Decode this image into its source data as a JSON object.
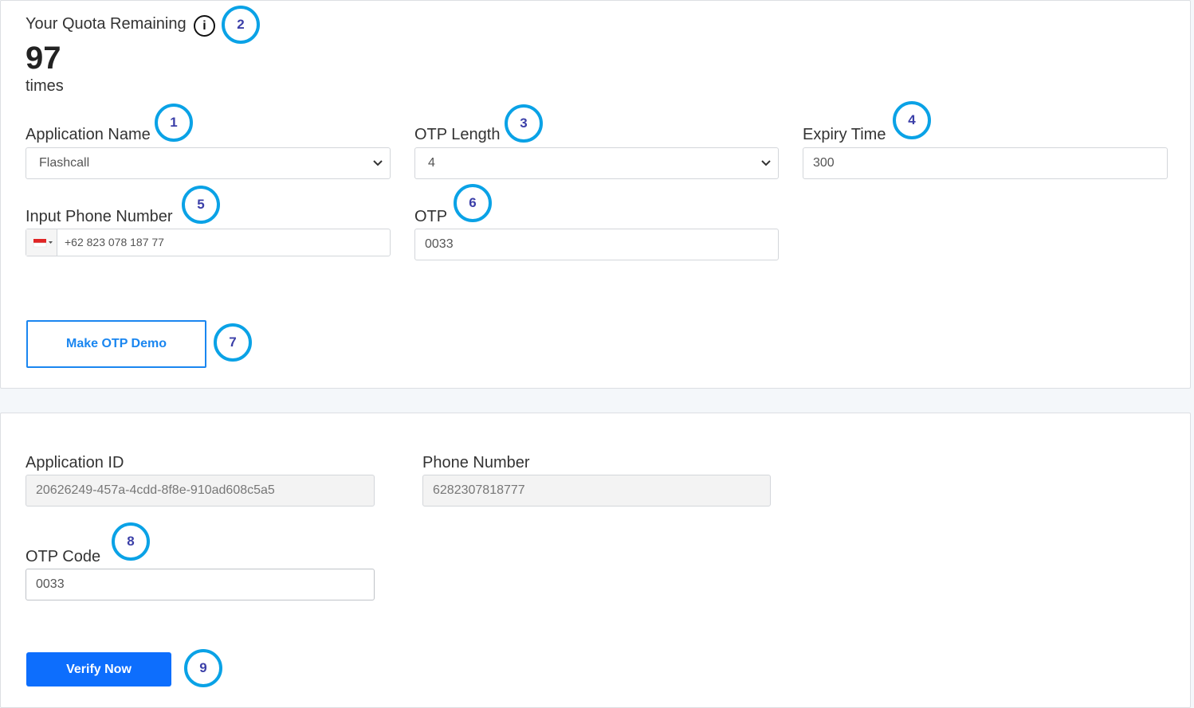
{
  "quota": {
    "title": "Your Quota Remaining",
    "info_icon": "info-icon",
    "count": "97",
    "unit": "times"
  },
  "form": {
    "app_name": {
      "label": "Application Name",
      "value": "Flashcall"
    },
    "otp_length": {
      "label": "OTP Length",
      "value": "4"
    },
    "expiry_time": {
      "label": "Expiry Time",
      "value": "300"
    },
    "phone": {
      "label": "Input Phone Number",
      "value": "+62 823 078 187 77",
      "country_icon": "indonesia-flag-icon"
    },
    "otp": {
      "label": "OTP",
      "value": "0033"
    },
    "make_button": "Make OTP Demo"
  },
  "verify": {
    "app_id": {
      "label": "Application ID",
      "value": "20626249-457a-4cdd-8f8e-910ad608c5a5"
    },
    "phone_number": {
      "label": "Phone Number",
      "value": "6282307818777"
    },
    "otp_code": {
      "label": "OTP Code",
      "value": "0033"
    },
    "verify_button": "Verify Now"
  },
  "badges": [
    "1",
    "2",
    "3",
    "4",
    "5",
    "6",
    "7",
    "8",
    "9"
  ],
  "colors": {
    "accent": "#0d6efd",
    "outline_button": "#1a86f0",
    "badge_ring": "#0aa2e6",
    "badge_text": "#3b3fa8"
  }
}
